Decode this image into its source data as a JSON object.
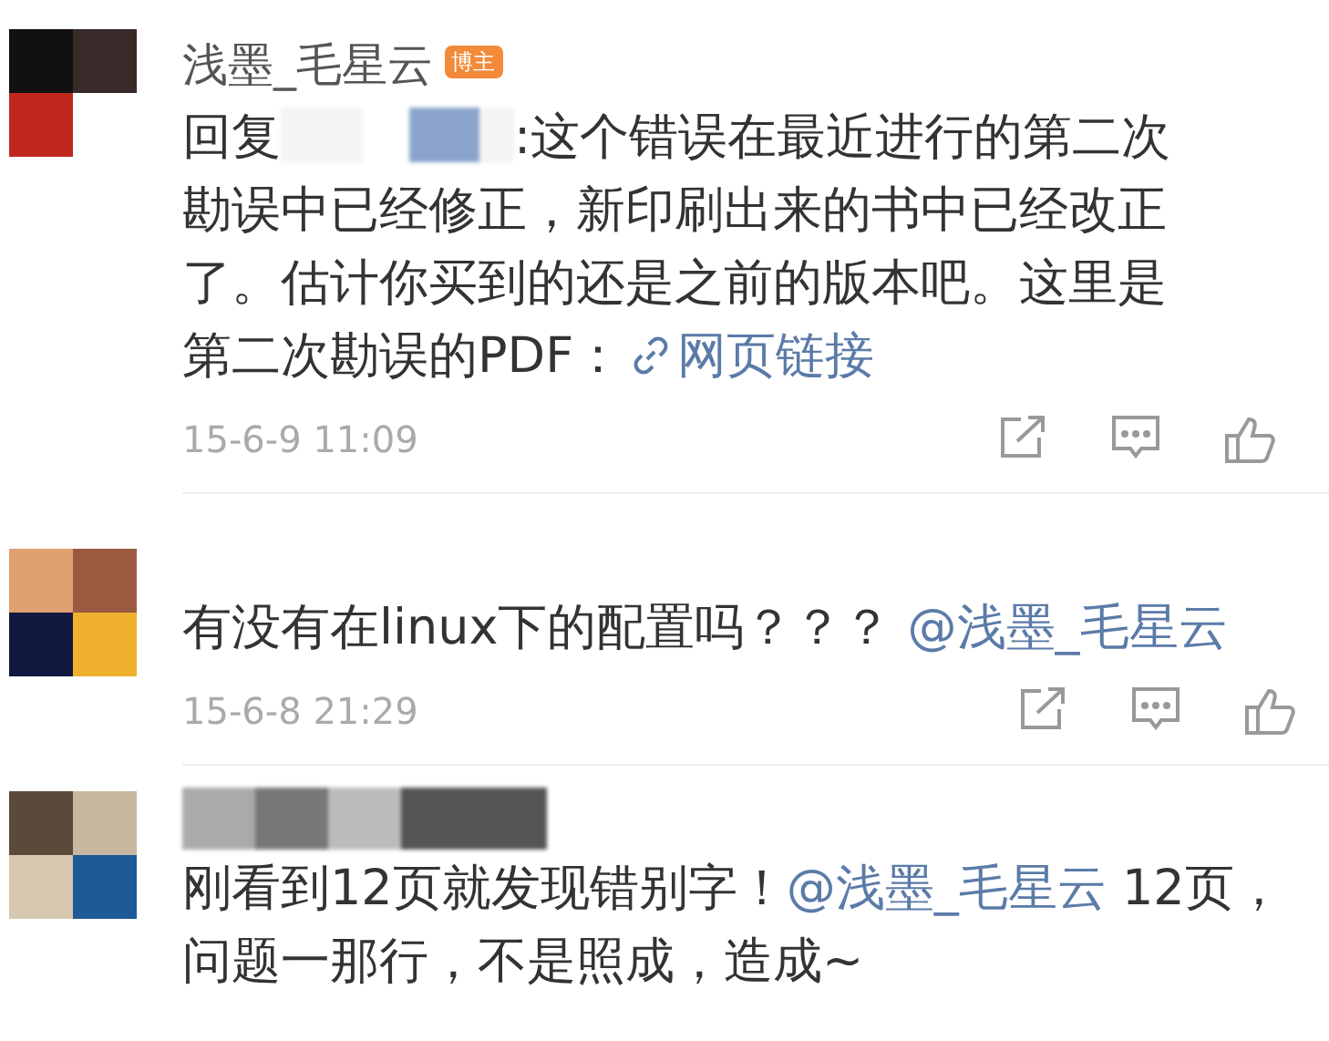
{
  "comments": [
    {
      "author": "浅墨_毛星云",
      "badge": "博主",
      "segments": [
        {
          "kind": "text",
          "text": "回复"
        },
        {
          "kind": "redacted"
        },
        {
          "kind": "text",
          "text": ":这个错误在最近进行的第二次勘误中已经修正，新印刷出来的书中已经改正了。估计你买到的还是之前的版本吧。这里是第二次勘误的PDF："
        },
        {
          "kind": "link",
          "text": "网页链接"
        }
      ],
      "time": "15-6-9 11:09"
    },
    {
      "segments": [
        {
          "kind": "text",
          "text": "有没有在linux下的配置吗？？？ "
        },
        {
          "kind": "mention",
          "text": "@浅墨_毛星云"
        }
      ],
      "time": "15-6-8 21:29"
    },
    {
      "author_hidden": true,
      "segments": [
        {
          "kind": "text",
          "text": "刚看到12页就发现错别字！"
        },
        {
          "kind": "mention",
          "text": "@浅墨_毛星云"
        },
        {
          "kind": "text",
          "text": " 12页，问题一那行，不是照成，造成~"
        }
      ]
    }
  ]
}
